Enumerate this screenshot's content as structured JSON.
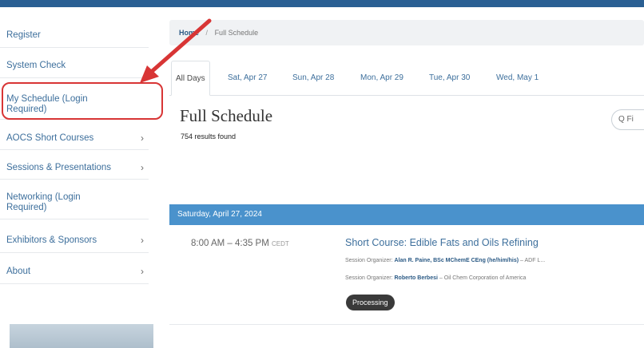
{
  "sidebar": {
    "items": [
      {
        "label": "Register",
        "chevron": ""
      },
      {
        "label": "System Check",
        "chevron": ""
      },
      {
        "label": "My Schedule (Login Required)",
        "chevron": ""
      },
      {
        "label": "AOCS Short Courses",
        "chevron": "›"
      },
      {
        "label": "Sessions & Presentations",
        "chevron": "›"
      },
      {
        "label": "Networking (Login Required)",
        "chevron": ""
      },
      {
        "label": "Exhibitors & Sponsors",
        "chevron": "›"
      },
      {
        "label": "About",
        "chevron": "›"
      }
    ]
  },
  "breadcrumb": {
    "home": "Home",
    "separator": "/",
    "current": "Full Schedule"
  },
  "tabs": [
    "All Days",
    "Sat, Apr 27",
    "Sun, Apr 28",
    "Mon, Apr 29",
    "Tue, Apr 30",
    "Wed, May 1"
  ],
  "main": {
    "title": "Full Schedule",
    "results": "754 results found",
    "search_placeholder": "Q Fi"
  },
  "day": {
    "label": "Saturday, April 27, 2024"
  },
  "session": {
    "time": "8:00 AM – 4:35 PM",
    "tz": "CEDT",
    "title": "Short Course: Edible Fats and Oils Refining",
    "organizers": [
      {
        "prefix": "Session Organizer:",
        "name": "Alan R. Paine, BSc MChemE CEng (he/him/his)",
        "suffix": "– ADF L..."
      },
      {
        "prefix": "Session Organizer:",
        "name": "Roberto Berbesi",
        "suffix": "– Oil Chem Corporation of America"
      }
    ],
    "badge": "Processing"
  },
  "colors": {
    "accent": "#4a92cc",
    "link": "#3d6f9c",
    "annotation": "#d83535",
    "topbar": "#2a5f93"
  }
}
